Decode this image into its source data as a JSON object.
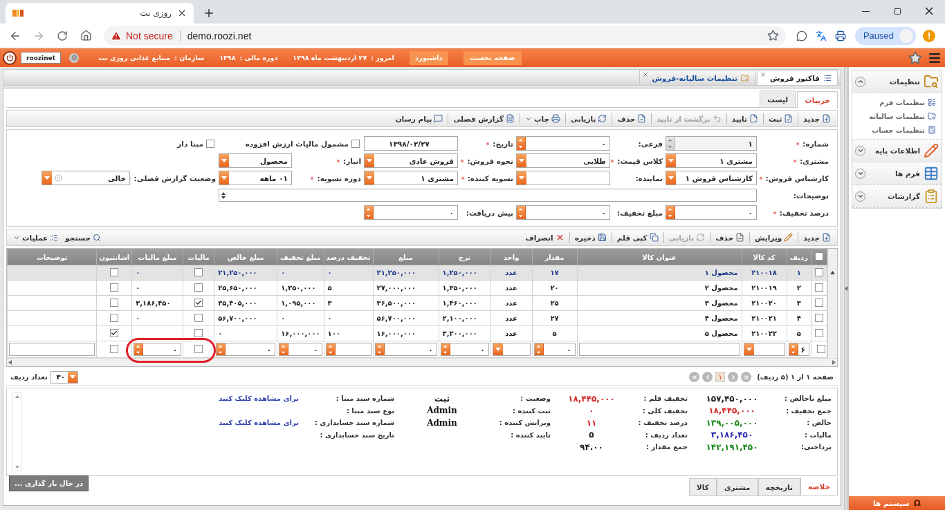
{
  "browser": {
    "tab_title": "روزی نت",
    "security_label": "Not secure",
    "url": "demo.roozi.net",
    "profile_label": "Paused"
  },
  "header": {
    "user": "roozinet",
    "buttons": [
      "صفحه نخست",
      "داشبورد"
    ],
    "info": [
      {
        "label": "امروز :",
        "value": "۲۷ اردیبهشت ماه ۱۳۹۸"
      },
      {
        "label": "دوره مالی :",
        "value": "۱۳۹۸"
      },
      {
        "label": "سازمان :",
        "value": "صنایع غذایی روزی نت"
      }
    ]
  },
  "document_tabs": [
    {
      "label": "فاکتور فروش",
      "selected": true
    },
    {
      "label": "تنظیمات سالیانه-فروش",
      "selected": false
    }
  ],
  "view_tabs": [
    {
      "label": "جزییات",
      "selected": true
    },
    {
      "label": "لیست",
      "selected": false
    }
  ],
  "toolbar": [
    {
      "label": "جدید",
      "kind": "button",
      "disabled": false
    },
    {
      "label": "ثبت",
      "kind": "button",
      "disabled": false
    },
    {
      "label": "تایید",
      "kind": "button",
      "disabled": false
    },
    {
      "label": "برگشت از تایید",
      "kind": "button",
      "disabled": true
    },
    {
      "label": "حذف",
      "kind": "button",
      "disabled": false
    },
    {
      "label": "بازیابی",
      "kind": "button",
      "disabled": false
    },
    {
      "label": "چاپ",
      "kind": "menu",
      "disabled": false
    },
    {
      "label": "گزارش فصلی",
      "kind": "button",
      "disabled": false
    },
    {
      "label": "پیام رسان",
      "kind": "button",
      "disabled": false
    }
  ],
  "form": {
    "rows": [
      [
        {
          "kind": "spinner",
          "label": "شماره:",
          "required": true,
          "value": "۱",
          "disabled": true
        },
        {
          "kind": "spinner",
          "label": "فرعی:",
          "required": false,
          "value": "۰",
          "disabled": false
        },
        {
          "kind": "text",
          "label": "تاریخ:",
          "required": true,
          "value": "۱۳۹۸/۰۲/۲۷",
          "disabled": false
        },
        {
          "kind": "checkbox",
          "label": "مشمول مالیات ارزش افزوده",
          "checked": false
        },
        {
          "kind": "checkbox",
          "label": "مبنا دار",
          "checked": false
        }
      ],
      [
        {
          "kind": "select",
          "label": "مشتری:",
          "required": true,
          "value": "مشتری ۱",
          "disabled": false
        },
        {
          "kind": "select",
          "label": "کلاس قیمت:",
          "required": true,
          "value": "طلایی",
          "disabled": false
        },
        {
          "kind": "select",
          "label": "نحوه فروش:",
          "required": true,
          "value": "فروش عادی",
          "disabled": false
        },
        {
          "kind": "select",
          "label": "انبار:",
          "required": true,
          "value": "محصول",
          "disabled": false
        }
      ],
      [
        {
          "kind": "select",
          "label": "کارشناس فروش:",
          "required": true,
          "value": "کارشناس فروش ۱",
          "disabled": false
        },
        {
          "kind": "select",
          "label": "نماینده:",
          "required": false,
          "disabled": false
        },
        {
          "kind": "select",
          "label": "تسویه کننده:",
          "required": true,
          "value": "مشتری ۱",
          "disabled": false
        },
        {
          "kind": "select",
          "label": "دوره تسویه:",
          "required": true,
          "value": "۰۱ ماهه",
          "disabled": false
        },
        {
          "kind": "clearable",
          "label": "وضعیت گزارش فصلی:",
          "required": true,
          "value": "خالی",
          "disabled": false
        }
      ],
      [
        {
          "kind": "textarea",
          "label": "توضیحات:",
          "required": false,
          "disabled": false
        }
      ],
      [
        {
          "kind": "spinner",
          "label": "درصد تخفیف:",
          "required": true,
          "value": "۰",
          "disabled": false
        },
        {
          "kind": "spinner",
          "label": "مبلغ تخفیف:",
          "required": false,
          "value": "۰",
          "disabled": false
        },
        {
          "kind": "spinner",
          "label": "پیش دریافت:",
          "required": false,
          "value": "۰",
          "disabled": false
        }
      ]
    ]
  },
  "item_toolbar": [
    {
      "label": "جدید",
      "disabled": false
    },
    {
      "label": "ویرایش",
      "disabled": false
    },
    {
      "label": "حذف",
      "disabled": false
    },
    {
      "label": "بازیابی",
      "disabled": true
    },
    {
      "label": "کپی قلم",
      "disabled": false
    },
    {
      "label": "ذخیره",
      "disabled": false
    },
    {
      "label": "انصراف",
      "disabled": false
    }
  ],
  "item_actions": [
    {
      "label": "جستجو",
      "kind": "button"
    },
    {
      "label": "عملیات",
      "kind": "menu"
    }
  ],
  "table": {
    "header_checked": false,
    "columns": [
      "ردیف",
      "کد کالا",
      "عنوان کالا",
      "مقدار",
      "واحد",
      "نرخ",
      "مبلغ",
      "تخفیف درصد",
      "مبلغ تخفیف",
      "مبلغ خالص",
      "مالیات",
      "مبلغ مالیات",
      "اشانتیون",
      "توضیحات"
    ],
    "rows": [
      {
        "selected": true,
        "checked": false,
        "number": "۱",
        "code": "۲۱۰۰۱۸",
        "title": "محصول ۱",
        "quantity": "۱۷",
        "unit": "عدد",
        "rate": "۱,۲۵۰,۰۰۰",
        "amount": "۲۱,۲۵۰,۰۰۰",
        "discount_percent": "۰",
        "discount_amount": "۰",
        "net": "۲۱,۲۵۰,۰۰۰",
        "taxable": false,
        "tax_amount": "۰",
        "gift": false
      },
      {
        "selected": false,
        "checked": false,
        "number": "۲",
        "code": "۲۱۰۰۱۹",
        "title": "محصول ۲",
        "quantity": "۲۰",
        "unit": "عدد",
        "rate": "۱,۳۵۰,۰۰۰",
        "amount": "۲۷,۰۰۰,۰۰۰",
        "discount_percent": "۵",
        "discount_amount": "۱,۳۵۰,۰۰۰",
        "net": "۲۵,۶۵۰,۰۰۰",
        "taxable": false,
        "tax_amount": "۰",
        "gift": false
      },
      {
        "selected": false,
        "checked": false,
        "number": "۳",
        "code": "۲۱۰۰۲۰",
        "title": "محصول ۳",
        "quantity": "۲۵",
        "unit": "عدد",
        "rate": "۱,۴۶۰,۰۰۰",
        "amount": "۳۶,۵۰۰,۰۰۰",
        "discount_percent": "۳",
        "discount_amount": "۱,۰۹۵,۰۰۰",
        "net": "۳۵,۴۰۵,۰۰۰",
        "taxable": true,
        "tax_amount": "۳,۱۸۶,۴۵۰",
        "gift": false
      },
      {
        "selected": false,
        "checked": false,
        "number": "۴",
        "code": "۲۱۰۰۲۱",
        "title": "محصول ۴",
        "quantity": "۲۷",
        "unit": "عدد",
        "rate": "۲,۱۰۰,۰۰۰",
        "amount": "۵۶,۷۰۰,۰۰۰",
        "discount_percent": "۰",
        "discount_amount": "۰",
        "net": "۵۶,۷۰۰,۰۰۰",
        "taxable": false,
        "tax_amount": "۰",
        "gift": false
      },
      {
        "selected": false,
        "checked": false,
        "number": "۵",
        "code": "۲۱۰۰۲۲",
        "title": "محصول ۵",
        "quantity": "۵",
        "unit": "عدد",
        "rate": "۳,۲۰۰,۰۰۰",
        "amount": "۱۶,۰۰۰,۰۰۰",
        "discount_percent": "۱۰۰",
        "discount_amount": "۱۶,۰۰۰,۰۰۰",
        "net": "۰",
        "taxable": false,
        "gift": true
      }
    ],
    "edit_row": {
      "checked": false,
      "number": "۶",
      "quantity": "۰",
      "rate": "۰",
      "amount": "۰",
      "discount_amount": "۰",
      "net": "۰",
      "taxable": false,
      "tax_amount": "۰",
      "gift": false
    },
    "highlight": {
      "kind": "ellipse"
    }
  },
  "pagination": {
    "summary": "صفحه ۱ از ۱ (۵ ردیف)",
    "pages": [
      {
        "label": "۱",
        "selected": true
      }
    ],
    "page_size": "۳۰",
    "page_size_label": "تعداد ردیف"
  },
  "summary": {
    "columns": [
      [
        {
          "label": "مبلغ ناخالص :",
          "value": "۱۵۷,۴۵۰,۰۰۰",
          "color": "#222222"
        },
        {
          "label": "جمع تخفیف :",
          "value": "۱۸,۴۴۵,۰۰۰",
          "color": "#d42a2a"
        },
        {
          "label": "خالص :",
          "value": "۱۳۹,۰۰۵,۰۰۰",
          "color": "#1c8a1c"
        },
        {
          "label": "مالیات :",
          "value": "۳,۱۸۶,۴۵۰",
          "color": "#2b2bb0"
        },
        {
          "label": "پرداختی:",
          "value": "۱۴۲,۱۹۱,۴۵۰",
          "color": "#1c8a1c"
        }
      ],
      [
        {
          "label": "تخفیف قلم :",
          "value": "۱۸,۴۴۵,۰۰۰",
          "color": "#d42a2a"
        },
        {
          "label": "تخفیف کلی :",
          "value": "۰",
          "color": "#d42a2a"
        },
        {
          "label": "درصد تخفیف :",
          "value": "۱۱",
          "color": "#d42a2a"
        },
        {
          "label": "تعداد ردیف :",
          "value": "۵",
          "color": "#222222"
        },
        {
          "label": "جمع مقدار :",
          "value": "۹۴.۰۰",
          "color": "#222222"
        }
      ],
      [
        {
          "label": "وضعیت :",
          "value": "ثبت",
          "kind": "text"
        },
        {
          "label": "ثبت کننده :",
          "value": "Admin",
          "kind": "text"
        },
        {
          "label": "ویرایش کننده :",
          "value": "Admin",
          "kind": "text"
        },
        {
          "label": "تایید کننده :"
        }
      ],
      [
        {
          "label": "شماره سند مبنا :",
          "value": "برای مشاهده کلیک کنید",
          "kind": "link"
        },
        {
          "label": "نوع سند مبنا :"
        },
        {
          "label": "شماره سند حسابداری :",
          "value": "برای مشاهده کلیک کنید",
          "kind": "link"
        },
        {
          "label": "تاریخ سند حسابداری :"
        }
      ]
    ]
  },
  "bottom_tabs": [
    {
      "label": "خلاصه",
      "selected": true
    },
    {
      "label": "تاریخچه",
      "selected": false
    },
    {
      "label": "مشتری",
      "selected": false
    },
    {
      "label": "کالا",
      "selected": false
    }
  ],
  "loading_button": "در حال بار گذاری ...",
  "sidebar": {
    "sections": [
      {
        "label": "تنظیمات",
        "expanded": true,
        "children": [
          {
            "label": "تنظیمات فرم"
          },
          {
            "label": "تنظیمات سالیانه"
          },
          {
            "label": "تنظیمات حساب"
          }
        ]
      },
      {
        "label": "اطلاعات پایه",
        "expanded": false
      },
      {
        "label": "فرم ها",
        "expanded": false
      },
      {
        "label": "گزارشات",
        "expanded": false
      }
    ],
    "footer": {
      "symbol": "Ω",
      "label": "سیستم ها"
    }
  }
}
